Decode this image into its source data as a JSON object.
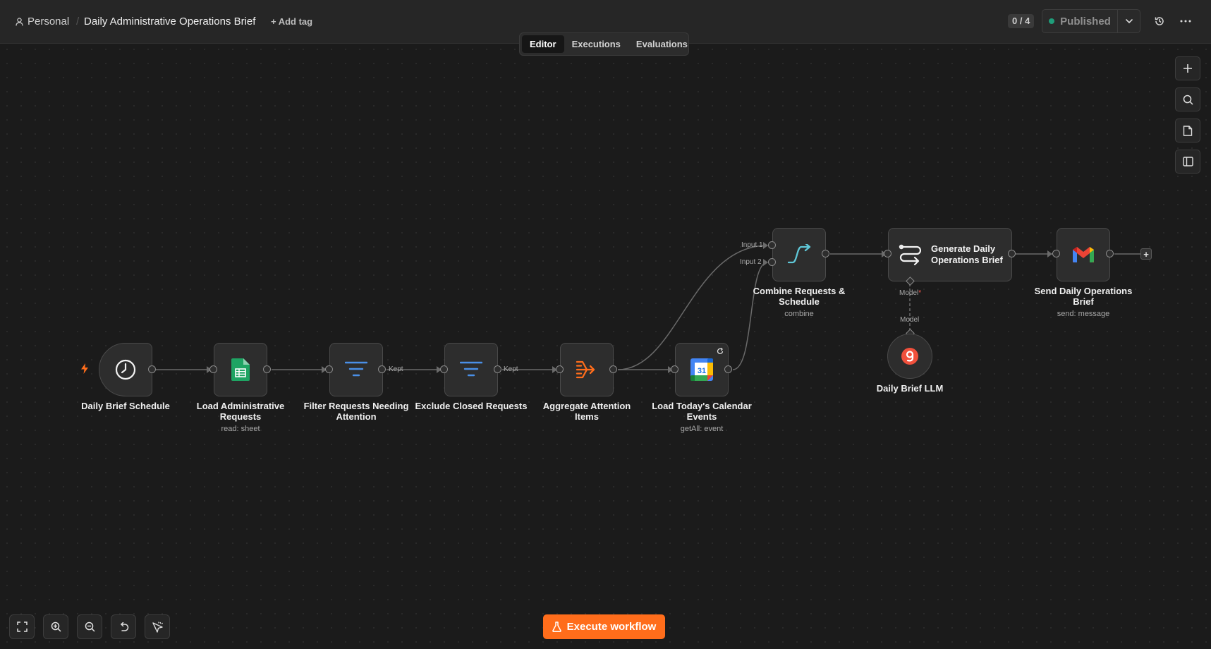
{
  "header": {
    "project": "Personal",
    "workflow_title": "Daily Administrative Operations Brief",
    "add_tag": "+ Add tag",
    "counter": "0 / 4",
    "status": "Published"
  },
  "tabs": [
    {
      "label": "Editor",
      "active": true
    },
    {
      "label": "Executions",
      "active": false
    },
    {
      "label": "Evaluations",
      "active": false
    }
  ],
  "nodes": {
    "schedule": {
      "label": "Daily Brief Schedule"
    },
    "load_requests": {
      "label": "Load Administrative Requests",
      "subtitle": "read: sheet"
    },
    "filter_attention": {
      "label": "Filter Requests Needing Attention"
    },
    "exclude_closed": {
      "label": "Exclude Closed Requests"
    },
    "aggregate": {
      "label": "Aggregate Attention Items"
    },
    "calendar": {
      "label": "Load Today's Calendar Events",
      "subtitle": "getAll: event"
    },
    "combine": {
      "label": "Combine Requests & Schedule",
      "subtitle": "combine",
      "input1": "Input 1",
      "input2": "Input 2"
    },
    "generate": {
      "label": "Generate Daily Operations Brief",
      "model_port": "Model",
      "required_mark": "*"
    },
    "llm": {
      "label": "Daily Brief LLM",
      "connection": "Model"
    },
    "send": {
      "label": "Send Daily Operations Brief",
      "subtitle": "send: message"
    }
  },
  "edge_labels": {
    "kept_1": "Kept",
    "kept_2": "Kept"
  },
  "actions": {
    "execute": "Execute workflow",
    "add_node": "+"
  },
  "colors": {
    "accent": "#ff6d1b",
    "published_dot": "#1f9d7a",
    "canvas": "#1b1b1b"
  }
}
